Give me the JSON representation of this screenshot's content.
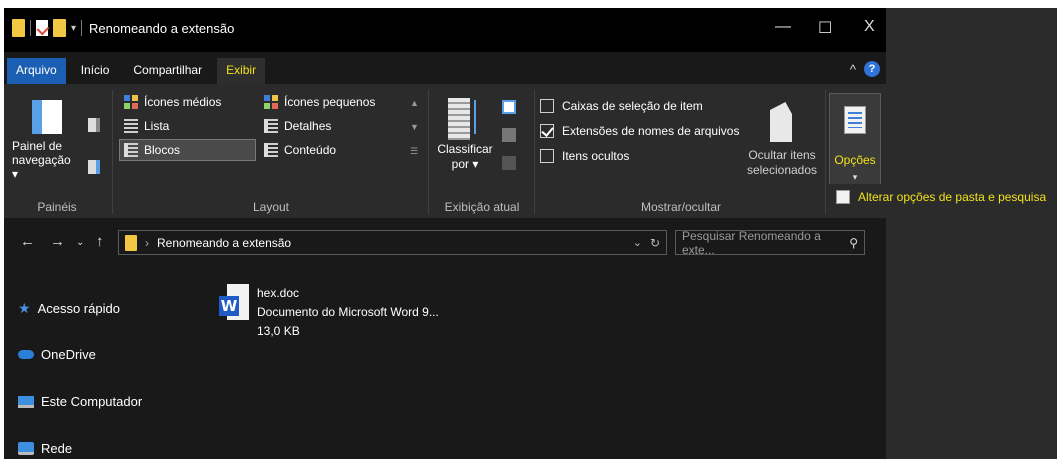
{
  "window": {
    "title": "Renomeando a extensão"
  },
  "window_controls": {
    "minimize": "—",
    "maximize": "☐",
    "close": "X"
  },
  "tabs": [
    {
      "label": "Arquivo"
    },
    {
      "label": "Início"
    },
    {
      "label": "Compartilhar"
    },
    {
      "label": "Exibir"
    }
  ],
  "ribbon": {
    "paineis": {
      "nav_pane_label_1": "Painel de",
      "nav_pane_label_2": "navegação ▾",
      "group_label": "Painéis"
    },
    "layout": {
      "items": [
        "Ícones médios",
        "Ícones pequenos",
        "Lista",
        "Detalhes",
        "Blocos",
        "Conteúdo"
      ],
      "group_label": "Layout"
    },
    "exibicao_atual": {
      "sort_label_1": "Classificar",
      "sort_label_2": "por ▾",
      "group_label": "Exibição atual"
    },
    "mostrar_ocultar": {
      "checkboxes": [
        {
          "label": "Caixas de seleção de item",
          "checked": false
        },
        {
          "label": "Extensões de nomes de arquivos",
          "checked": true
        },
        {
          "label": "Itens ocultos",
          "checked": false
        }
      ],
      "hide_label_1": "Ocultar itens",
      "hide_label_2": "selecionados",
      "group_label": "Mostrar/ocultar"
    },
    "opcoes": {
      "label": "Opções",
      "arrow": "▾"
    }
  },
  "tooltip": {
    "text": "Alterar opções de pasta e pesquisa"
  },
  "address": {
    "path": "Renomeando a extensão",
    "search_placeholder": "Pesquisar Renomeando a exte..."
  },
  "nav_pane": [
    {
      "label": "Acesso rápido",
      "icon": "star-icon"
    },
    {
      "label": "OneDrive",
      "icon": "cloud-icon"
    },
    {
      "label": "Este Computador",
      "icon": "computer-icon"
    },
    {
      "label": "Rede",
      "icon": "network-icon"
    }
  ],
  "file": {
    "name": "hex.doc",
    "type": "Documento do Microsoft Word 9...",
    "size": "13,0 KB"
  },
  "colors": {
    "accent_yellow": "#f2e21a",
    "file_tab_blue": "#1a5fb4",
    "folder_yellow": "#f2c744"
  }
}
